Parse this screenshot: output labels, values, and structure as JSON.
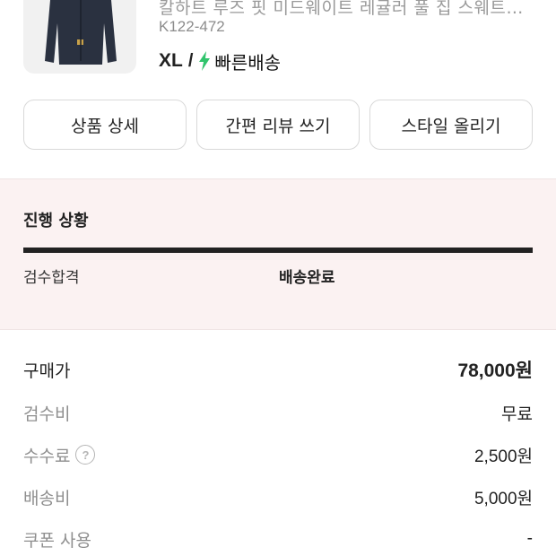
{
  "product": {
    "name": "칼하트 루즈 핏 미드웨이트 레귤러 풀 집 스웨트셔츠 블랙",
    "code": "K122-472",
    "size": "XL",
    "separator": "/",
    "delivery": "빠른배송",
    "delivery_icon": "lightning-bolt-icon",
    "bolt_color": "#31c46d"
  },
  "actions": {
    "detail": "상품 상세",
    "review": "간편 리뷰 쓰기",
    "style": "스타일 올리기"
  },
  "progress": {
    "title": "진행 상황",
    "steps": [
      "검수합격",
      "배송완료"
    ],
    "current_step": "배송완료",
    "background": "#fbf2f2"
  },
  "prices": {
    "purchase": {
      "label": "구매가",
      "value": "78,000원"
    },
    "inspection": {
      "label": "검수비",
      "value": "무료"
    },
    "fee": {
      "label": "수수료",
      "value": "2,500원",
      "help_icon": "question-circle-icon"
    },
    "shipping": {
      "label": "배송비",
      "value": "5,000원"
    },
    "coupon": {
      "label": "쿠폰 사용",
      "value": "-"
    }
  }
}
